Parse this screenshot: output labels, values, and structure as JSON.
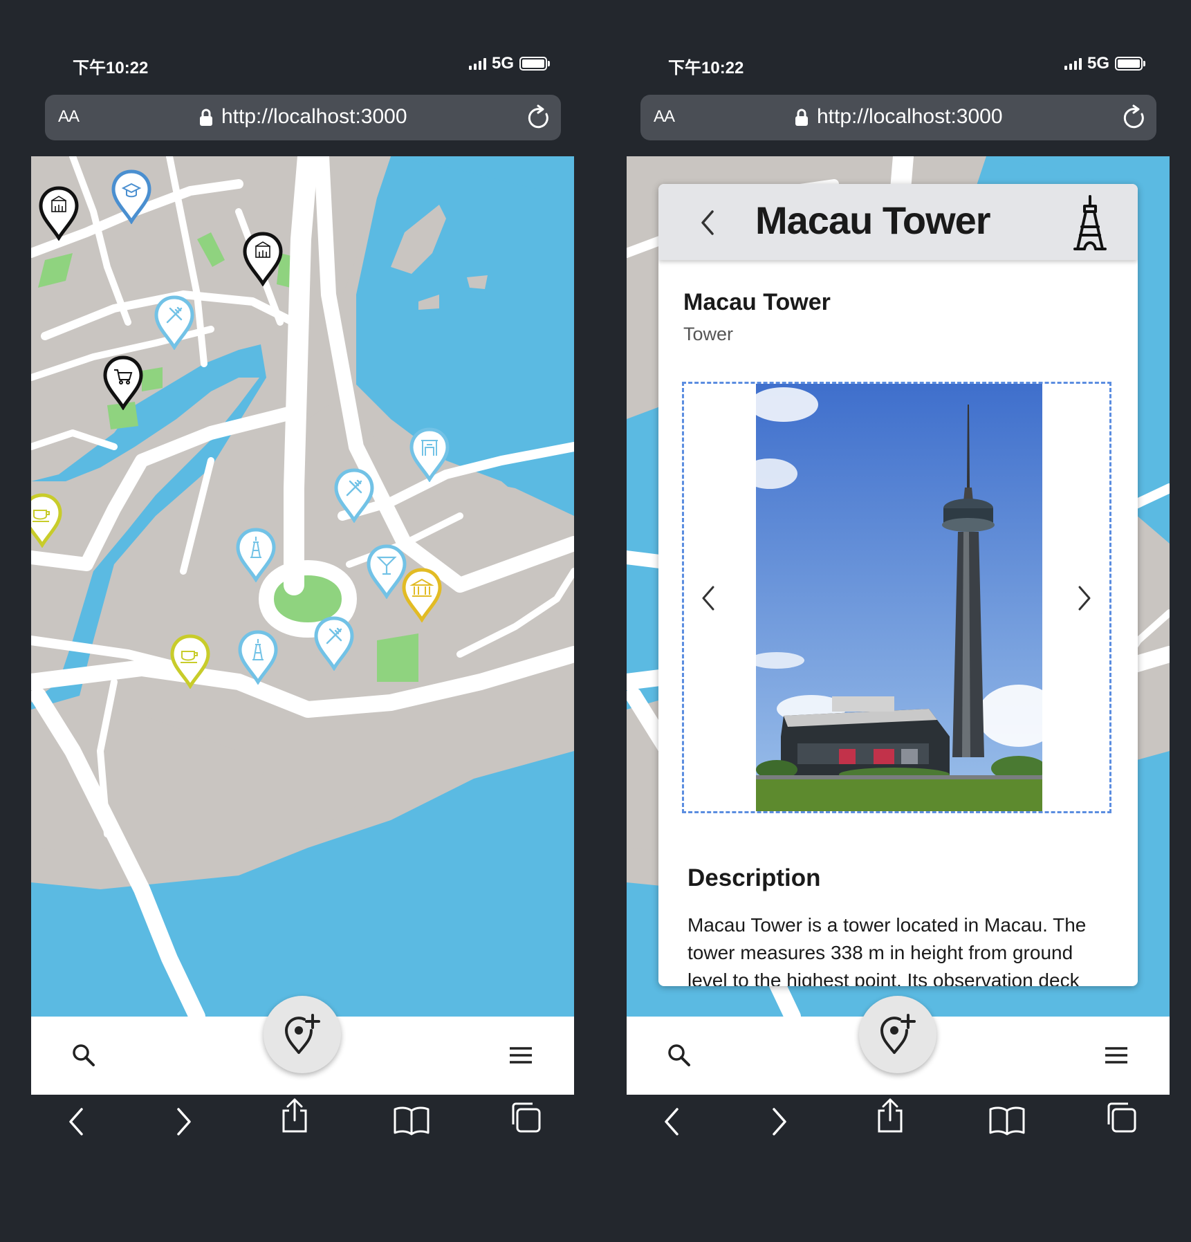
{
  "status_bar": {
    "time": "下午10:22",
    "network": "5G"
  },
  "browser": {
    "text_size_label": "AA",
    "url": "http://localhost:3000"
  },
  "bottom_nav": {
    "search_icon": "search-icon",
    "add_place_icon": "add-location-icon",
    "menu_icon": "hamburger-menu-icon"
  },
  "detail": {
    "header_title": "Macau Tower",
    "name": "Macau Tower",
    "type": "Tower",
    "description_heading": "Description",
    "description": "Macau Tower is a tower located in Macau. The tower measures 338 m in height from ground level to the highest point. Its observation deck"
  },
  "map_markers": [
    {
      "category": "landmark",
      "color": "#111111"
    },
    {
      "category": "school",
      "color": "#4a8fd0"
    },
    {
      "category": "landmark",
      "color": "#111111"
    },
    {
      "category": "restaurant",
      "color": "#72c2e6"
    },
    {
      "category": "shopping",
      "color": "#111111"
    },
    {
      "category": "temple",
      "color": "#72c2e6"
    },
    {
      "category": "restaurant",
      "color": "#72c2e6"
    },
    {
      "category": "cafe",
      "color": "#c8cc2a"
    },
    {
      "category": "tower",
      "color": "#72c2e6"
    },
    {
      "category": "bar",
      "color": "#72c2e6"
    },
    {
      "category": "museum",
      "color": "#e2bb24"
    },
    {
      "category": "cafe",
      "color": "#c8cc2a"
    },
    {
      "category": "tower",
      "color": "#72c2e6"
    },
    {
      "category": "restaurant",
      "color": "#72c2e6"
    }
  ],
  "colors": {
    "water": "#5bbae2",
    "land": "#c9c5c1",
    "park": "#8fd37f",
    "accent": "#5b8de0",
    "frame": "#23272d"
  }
}
